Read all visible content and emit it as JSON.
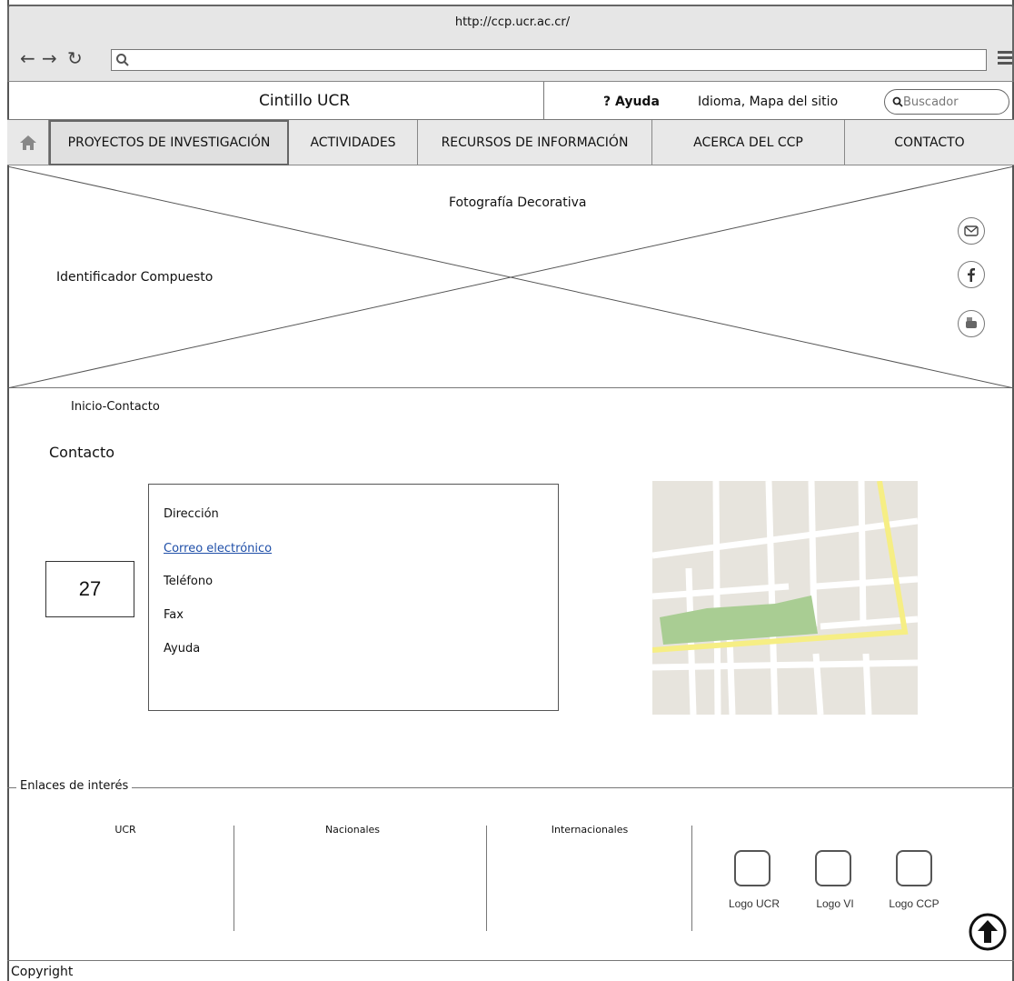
{
  "browser": {
    "url": "http://ccp.ucr.ac.cr/"
  },
  "header": {
    "cintillo": "Cintillo UCR",
    "help": "Ayuda",
    "links": "Idioma, Mapa del sitio",
    "search_placeholder": "Buscador"
  },
  "menu": {
    "items": [
      {
        "label": "PROYECTOS DE INVESTIGACIÓN"
      },
      {
        "label": "ACTIVIDADES"
      },
      {
        "label": "RECURSOS DE INFORMACIÓN"
      },
      {
        "label": "ACERCA DEL CCP"
      },
      {
        "label": "CONTACTO"
      }
    ]
  },
  "hero": {
    "photo_label": "Fotografía Decorativa",
    "identifier": "Identificador Compuesto"
  },
  "content": {
    "breadcrumb": "Inicio-Contacto",
    "title": "Contacto",
    "items": [
      {
        "label": "Dirección"
      },
      {
        "label": "Correo electrónico"
      },
      {
        "label": "Teléfono"
      },
      {
        "label": "Fax"
      },
      {
        "label": "Ayuda"
      }
    ],
    "number": "27"
  },
  "links": {
    "title": "Enlaces de interés",
    "columns": [
      "UCR",
      "Nacionales",
      "Internacionales"
    ],
    "logos": [
      "Logo UCR",
      "Logo VI",
      "Logo CCP"
    ]
  },
  "footer": {
    "copyright": "Copyright"
  }
}
